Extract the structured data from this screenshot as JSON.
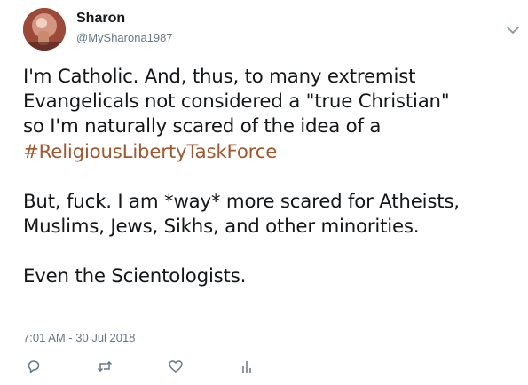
{
  "tweet": {
    "author_name": "Sharon",
    "author_handle": "@MySharona1987",
    "body": {
      "line1": "I'm Catholic. And, thus, to many extremist",
      "line2": "Evangelicals not considered a \"true Christian\"",
      "line3": "so I'm naturally scared of the idea of a",
      "hashtag": "#ReligiousLibertyTaskForce",
      "line5": "But, fuck. I am *way* more scared for Atheists,",
      "line6": "Muslims, Jews, Sikhs, and other minorities.",
      "line7": "Even the Scientologists."
    },
    "timestamp": "7:01 AM - 30 Jul 2018"
  },
  "icons": {
    "menu": "chevron-down-icon",
    "reply": "reply-icon",
    "retweet": "retweet-icon",
    "like": "heart-icon",
    "analytics": "analytics-icon"
  },
  "colors": {
    "hashtag": "#a2572f",
    "secondary_text": "#657786",
    "primary_text": "#14171a"
  }
}
